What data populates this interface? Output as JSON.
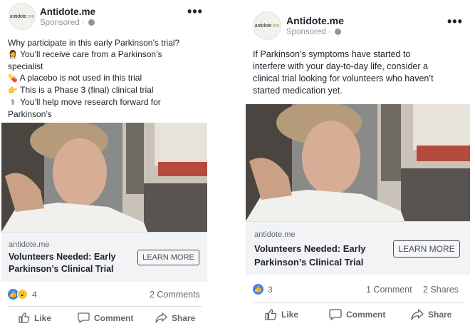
{
  "posts": [
    {
      "page_name": "Antidote.me",
      "avatar_text": "antidote",
      "avatar_dot": ".me",
      "sponsored": "Sponsored ·",
      "text_lines": [
        {
          "icon": "",
          "text": "Why participate in this early Parkinson’s trial?"
        },
        {
          "icon": "👩‍⚕️",
          "text": "You’ll receive care from a Parkinson’s"
        },
        {
          "icon": "",
          "text": "specialist"
        },
        {
          "icon": "💊",
          "text": "A placebo is not used in this trial"
        },
        {
          "icon": "👉",
          "text": "This is a Phase 3 (final) clinical trial"
        },
        {
          "icon": "⚕",
          "text": "You’ll help move research forward for"
        },
        {
          "icon": "",
          "text": "Parkinson’s"
        }
      ],
      "link": {
        "domain": "antidote.me",
        "title_line1": "Volunteers Needed: Early",
        "title_line2": "Parkinson’s Clinical Trial",
        "button": "LEARN MORE"
      },
      "reaction_count": "4",
      "comments": "2 Comments",
      "shares": "",
      "actions": {
        "like": "Like",
        "comment": "Comment",
        "share": "Share"
      }
    },
    {
      "page_name": "Antidote.me",
      "avatar_text": "antidote",
      "avatar_dot": ".me",
      "sponsored": "Sponsored ·",
      "text_lines": [
        {
          "icon": "",
          "text": "If Parkinson’s symptoms have started to"
        },
        {
          "icon": "",
          "text": "interfere with your day-to-day life, consider a"
        },
        {
          "icon": "",
          "text": "clinical trial looking for volunteers who haven’t"
        },
        {
          "icon": "",
          "text": "started medication yet."
        }
      ],
      "link": {
        "domain": "antidote.me",
        "title_line1": "Volunteers Needed: Early",
        "title_line2": "Parkinson’s Clinical Trial",
        "button": "LEARN MORE"
      },
      "reaction_count": "3",
      "comments": "1 Comment",
      "shares": "2 Shares",
      "actions": {
        "like": "Like",
        "comment": "Comment",
        "share": "Share"
      }
    }
  ],
  "colors": {
    "facebook_blue": "#3b82f6",
    "meta_gray": "#606770",
    "link_box_bg": "#f2f3f5",
    "brand_green": "#7cb342"
  },
  "icons": {
    "more": "more-options-icon",
    "globe": "globe-icon",
    "like": "thumbs-up-icon",
    "comment": "comment-bubble-icon",
    "share": "share-arrow-icon",
    "wow": "wow-reaction-icon"
  }
}
